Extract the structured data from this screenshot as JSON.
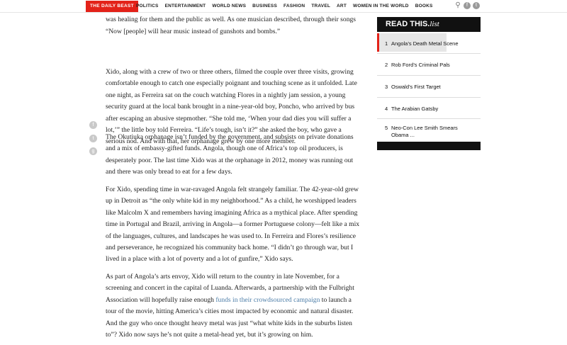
{
  "topbar": {
    "logo": "THE DAILY BEAST",
    "nav": [
      "POLITICS",
      "ENTERTAINMENT",
      "WORLD NEWS",
      "BUSINESS",
      "FASHION",
      "TRAVEL",
      "ART",
      "WOMEN IN THE WORLD",
      "BOOKS"
    ],
    "icons": [
      "search-icon",
      "facebook-icon",
      "twitter-icon"
    ]
  },
  "article": {
    "p1": "willing to speak about the war, the musicians could freely tell their stories through lyrics. It was healing for them and the public as well. As one musician described, through their songs “Now [people] will hear music instead of gunshots and bombs.”",
    "p2": "Xido, along with a crew of two or three others, filmed the couple over three visits, growing comfortable enough to catch one especially poignant and touching scene as it unfolded. Late one night, as Ferreira sat on the couch watching Flores in a nightly jam session, a young security guard at the local bank brought in a nine-year-old boy, Poncho, who arrived by bus after escaping an abusive stepmother. “She told me, ‘When your dad dies you will suffer a lot,’” the little boy told Ferreira. “Life’s tough, isn’t it?” she asked the boy, who gave a serious nod. And with that, her orphanage grew by one more member.",
    "p3": "The Okutiuka orphanage isn’t funded by the government, and subsists on private donations and a mix of embassy-gifted funds. Angola, though one of Africa’s top oil producers, is desperately poor. The last time Xido was at the orphanage in 2012, money was running out and there was only bread to eat for a few days.",
    "p4": "For Xido, spending time in war-ravaged Angola felt strangely familiar. The 42-year-old grew up in Detroit as “the only white kid in my neighborhood.” As a child, he worshipped leaders like Malcolm X and remembers having imagining Africa as a mythical place. After spending time in Portugal and Brazil, arriving in Angola—a former Portuguese colony—felt like a mix of the languages, cultures, and landscapes he was used to. In Ferreira and Flores’s resilience and perseverance, he recognized his community back home. “I didn’t go through war, but I lived in a place with a lot of poverty and a lot of gunfire,” Xido says.",
    "p5_before": "As part of Angola’s arts envoy, Xido will return to the country in late November, for a screening and concert in the capital of Luanda. Afterwards, a partnership with the Fulbright Association will hopefully raise enough ",
    "p5_link": "funds in their crowdsourced campaign",
    "p5_after": " to launch a tour of the movie, hitting America’s cities most impacted by economic and natural disaster. And the guy who once thought heavy metal was just “what white kids in the suburbs listen to”? Xido now says he’s not quite a metal-head yet, but it’s growing on him."
  },
  "share": [
    "facebook-share-icon",
    "twitter-share-icon",
    "google-plus-share-icon"
  ],
  "sidebar": {
    "title_bold": "READ THIS.",
    "title_italic": "list",
    "items": [
      {
        "num": "1",
        "label": "Angola’s Death Metal Scene"
      },
      {
        "num": "2",
        "label": "Rob Ford’s Criminal Pals"
      },
      {
        "num": "3",
        "label": "Oswald’s First Target"
      },
      {
        "num": "4",
        "label": "The Arabian Gatsby"
      },
      {
        "num": "5",
        "label": "Neo-Con Lee Smith Smears Obama ..."
      }
    ]
  }
}
